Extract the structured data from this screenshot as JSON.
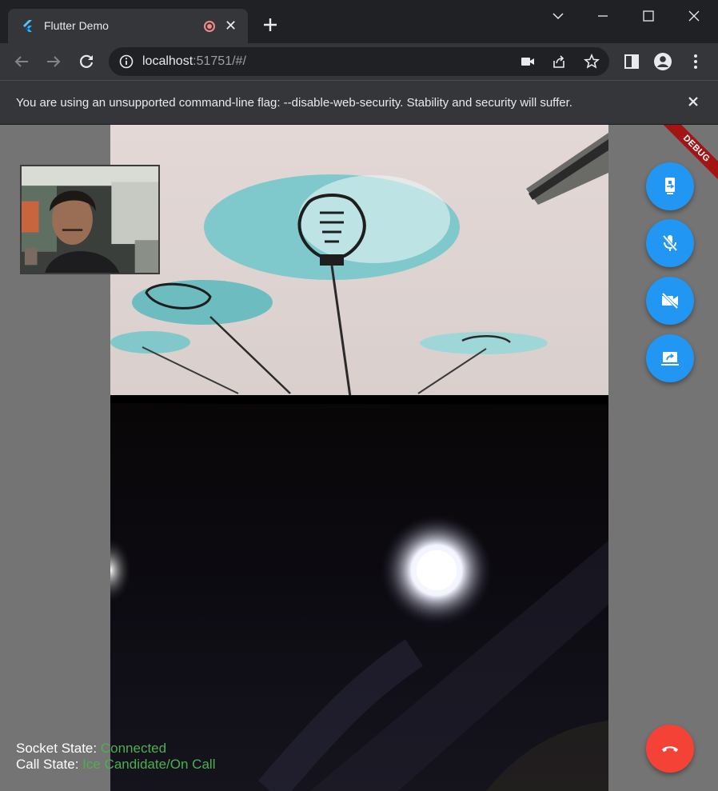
{
  "browser": {
    "tab_title": "Flutter Demo",
    "url_host": "localhost",
    "url_rest": ":51751/#/"
  },
  "infobar": {
    "message": "You are using an unsupported command-line flag: --disable-web-security. Stability and security will suffer."
  },
  "app": {
    "debug_banner": "DEBUG",
    "socket_state_label": "Socket State: ",
    "socket_state_value": "Connected",
    "call_state_label": "Call State: ",
    "call_state_value": "Ice Candidate/On Call"
  },
  "colors": {
    "fab_blue": "#2196f3",
    "end_call_red": "#f44336",
    "status_green": "#4caf50",
    "debug_red": "#a31515"
  },
  "icons": [
    "flutter-logo-icon",
    "record-icon",
    "close-icon",
    "plus-icon",
    "chevron-down-icon",
    "minimize-icon",
    "maximize-icon",
    "window-close-icon",
    "back-arrow-icon",
    "forward-arrow-icon",
    "reload-icon",
    "info-icon",
    "camera-icon",
    "share-icon",
    "star-icon",
    "side-panel-icon",
    "profile-icon",
    "more-vert-icon",
    "switch-camera-icon",
    "mic-off-icon",
    "videocam-off-icon",
    "screen-share-icon",
    "call-end-icon"
  ]
}
